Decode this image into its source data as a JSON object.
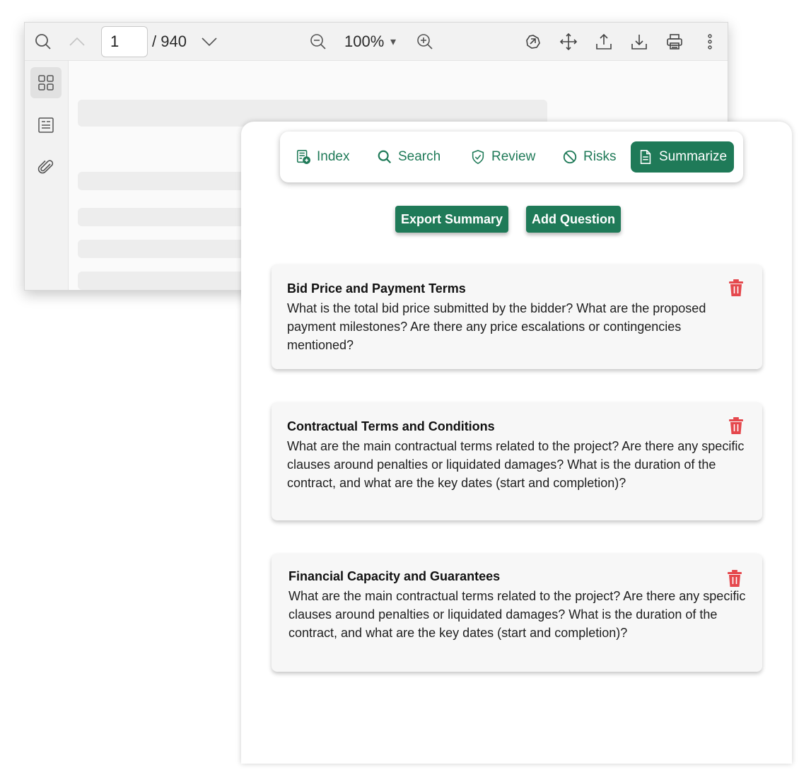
{
  "viewer": {
    "current_page": "1",
    "total_pages": "/ 940",
    "zoom": "100%",
    "zoom_caret": "▾"
  },
  "panel": {
    "tabs": [
      {
        "label": "Index"
      },
      {
        "label": "Search"
      },
      {
        "label": "Review"
      },
      {
        "label": "Risks"
      },
      {
        "label": "Summarize"
      }
    ],
    "active_tab": "Summarize",
    "export_label": "Export Summary",
    "add_question_label": "Add Question",
    "questions": [
      {
        "title": "Bid Price and Payment Terms",
        "body": "What is the total bid price submitted by the bidder? What are the proposed payment milestones? Are there any price escalations or contingencies mentioned?"
      },
      {
        "title": "Contractual Terms and Conditions",
        "body": "What are the main contractual terms related to the project? Are there any specific clauses around penalties or liquidated damages? What is the duration of the contract, and what are the key dates (start and completion)?"
      },
      {
        "title": "Financial Capacity and Guarantees",
        "body": "What are the main contractual terms related to the project? Are there any specific clauses around penalties or liquidated damages? What is the duration of the contract, and what are the key dates (start and completion)?"
      }
    ]
  },
  "colors": {
    "brand_green": "#1f7a58",
    "delete_red": "#e5484d",
    "card_bg": "#f7f7f7"
  },
  "icons": {
    "viewer_toolbar": [
      "search-icon",
      "chevron-up-icon",
      "chevron-down-icon",
      "zoom-out-icon",
      "zoom-in-icon",
      "rotate-icon",
      "pan-icon",
      "upload-icon",
      "download-icon",
      "print-icon",
      "more-vertical-icon"
    ],
    "viewer_rail": [
      "thumbnails-icon",
      "outline-icon",
      "attachment-icon"
    ],
    "tabs": [
      "index-icon",
      "search-icon",
      "shield-check-icon",
      "ban-icon",
      "document-icon"
    ],
    "card_action": "trash-icon"
  }
}
